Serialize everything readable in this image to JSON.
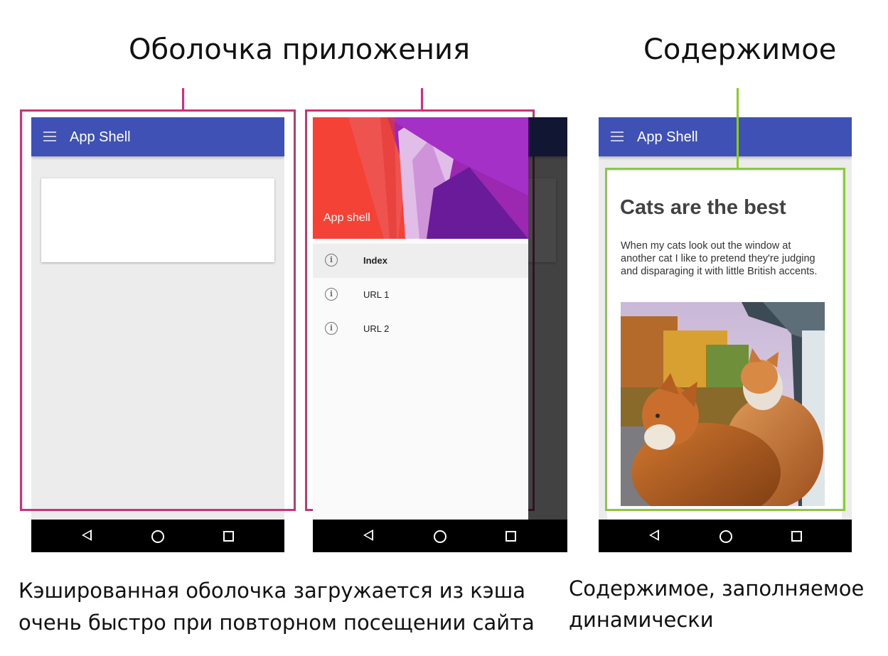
{
  "headings": {
    "shell": "Оболочка приложения",
    "content": "Содержимое"
  },
  "captions": {
    "shell_line1": "Кэшированная оболочка загружается из кэша",
    "shell_line2": "очень быстро при повторном посещении сайта",
    "content_line1": "Содержимое, заполняемое",
    "content_line2": "динамически"
  },
  "phone_shell": {
    "appbar_title": "App Shell",
    "menu_icon": "menu-icon"
  },
  "phone_drawer": {
    "header_title": "App shell",
    "items": [
      {
        "label": "Index",
        "icon": "info-icon",
        "active": true
      },
      {
        "label": "URL 1",
        "icon": "info-icon",
        "active": false
      },
      {
        "label": "URL 2",
        "icon": "info-icon",
        "active": false
      }
    ]
  },
  "phone_content": {
    "appbar_title": "App Shell",
    "article_title": "Cats are the best",
    "article_text": "When my cats look out the window at another cat I like to pretend they're judging and disparaging it with little British accents."
  },
  "colors": {
    "appbar": "#3f51b5",
    "shell_frame": "#cc3377",
    "content_frame": "#8dc63f",
    "navbar": "#000000"
  }
}
